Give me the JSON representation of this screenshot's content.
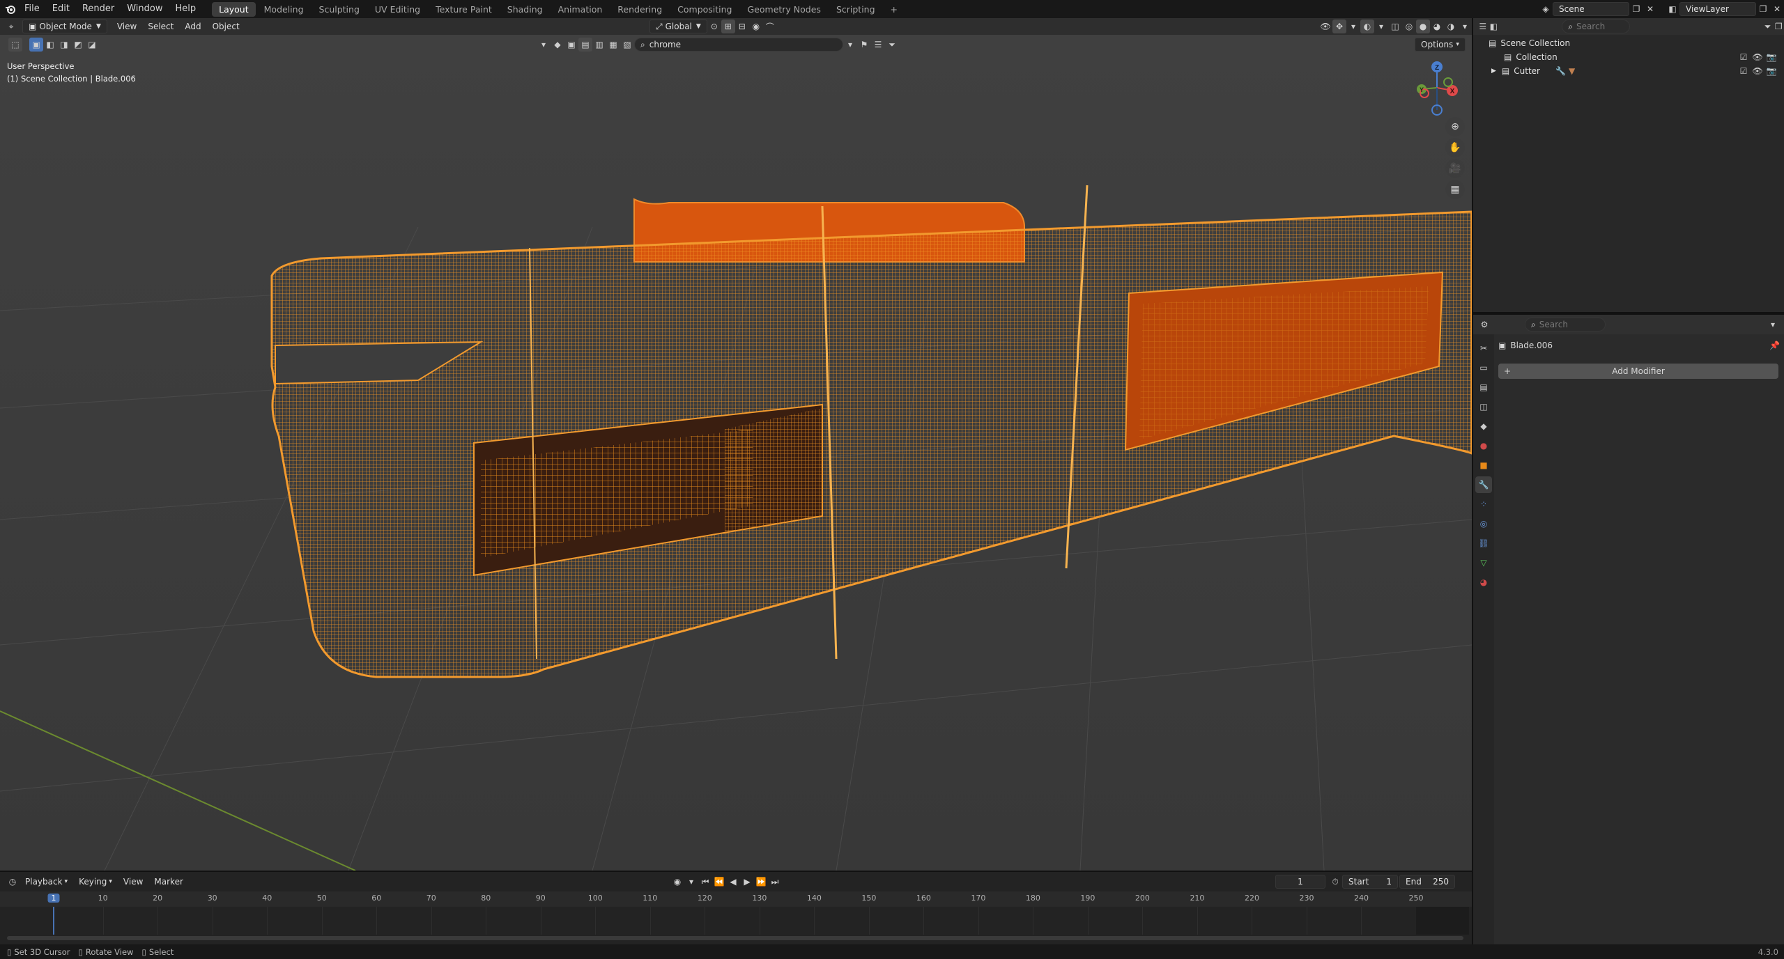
{
  "app": {
    "logo": "blender-logo-icon"
  },
  "menu": [
    "File",
    "Edit",
    "Render",
    "Window",
    "Help"
  ],
  "workspaces": [
    {
      "label": "Layout",
      "active": true
    },
    {
      "label": "Modeling"
    },
    {
      "label": "Sculpting"
    },
    {
      "label": "UV Editing"
    },
    {
      "label": "Texture Paint"
    },
    {
      "label": "Shading"
    },
    {
      "label": "Animation"
    },
    {
      "label": "Rendering"
    },
    {
      "label": "Compositing"
    },
    {
      "label": "Geometry Nodes"
    },
    {
      "label": "Scripting"
    }
  ],
  "workspace_add": "+",
  "scene": {
    "name": "Scene",
    "view_layer": "ViewLayer"
  },
  "viewport": {
    "mode": "Object Mode",
    "menus": [
      "View",
      "Select",
      "Add",
      "Object"
    ],
    "transform_orientation": "Global",
    "search_value": "chrome",
    "options_label": "Options",
    "info_line1": "User Perspective",
    "info_line2": "(1) Scene Collection | Blade.006"
  },
  "gizmo": {
    "z": "Z",
    "x": "X",
    "y": "Y"
  },
  "outliner": {
    "search_placeholder": "Search",
    "root": "Scene Collection",
    "items": [
      {
        "label": "Collection"
      },
      {
        "label": "Cutter"
      }
    ]
  },
  "properties": {
    "search_placeholder": "Search",
    "object_name": "Blade.006",
    "add_modifier": "Add Modifier"
  },
  "timeline": {
    "menus": [
      "Playback",
      "Keying",
      "View",
      "Marker"
    ],
    "current_frame": "1",
    "start_label": "Start",
    "start_value": "1",
    "end_label": "End",
    "end_value": "250",
    "ruler": [
      "1",
      "10",
      "20",
      "30",
      "40",
      "50",
      "60",
      "70",
      "80",
      "90",
      "100",
      "110",
      "120",
      "130",
      "140",
      "150",
      "160",
      "170",
      "180",
      "190",
      "200",
      "210",
      "220",
      "230",
      "240",
      "250"
    ]
  },
  "status": {
    "items": [
      "Set 3D Cursor",
      "Rotate View",
      "Select"
    ],
    "version": "4.3.0"
  },
  "colors": {
    "accent": "#4772b3",
    "selection": "#ff9a1f",
    "wire": "#e88a19"
  }
}
